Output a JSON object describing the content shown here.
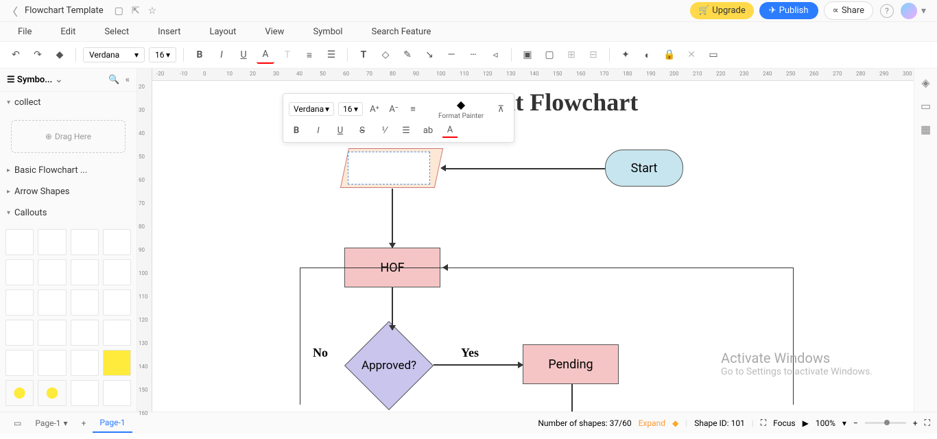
{
  "titlebar": {
    "doc_title": "Flowchart Template",
    "upgrade": "Upgrade",
    "publish": "Publish",
    "share": "Share"
  },
  "menus": {
    "file": "File",
    "edit": "Edit",
    "select": "Select",
    "insert": "Insert",
    "layout": "Layout",
    "view": "View",
    "symbol": "Symbol",
    "search": "Search Feature"
  },
  "toolbar": {
    "font": "Verdana",
    "size": "16"
  },
  "left": {
    "title": "Symbo...",
    "collect": "collect",
    "drag": "Drag Here",
    "basic": "Basic Flowchart ...",
    "arrows": "Arrow Shapes",
    "callouts": "Callouts"
  },
  "float": {
    "font": "Verdana",
    "size": "16",
    "format_painter": "Format Painter"
  },
  "flow": {
    "title": "Requirement Flowchart",
    "start": "Start",
    "hof": "HOF",
    "approved": "Approved?",
    "pending": "Pending",
    "no": "No",
    "yes": "Yes"
  },
  "tabs": {
    "page1": "Page-1",
    "page1_active": "Page-1"
  },
  "status": {
    "shapes_label": "Number of shapes: ",
    "shapes_count": "37/60",
    "expand": "Expand",
    "shape_id_label": "Shape ID: ",
    "shape_id": "101",
    "focus": "Focus",
    "zoom": "100%"
  },
  "watermark": {
    "l1": "Activate Windows",
    "l2": "Go to Settings to activate Windows."
  },
  "ruler_h": [
    "-20",
    "-10",
    "0",
    "10",
    "20",
    "30",
    "40",
    "50",
    "60",
    "70",
    "80",
    "90",
    "100",
    "110",
    "120",
    "130",
    "140",
    "150",
    "160",
    "170",
    "180",
    "190",
    "200",
    "210",
    "220",
    "230",
    "240",
    "250",
    "260",
    "270",
    "280",
    "290",
    "300"
  ],
  "ruler_v": [
    "20",
    "30",
    "40",
    "50",
    "60",
    "70",
    "80",
    "90",
    "100",
    "110",
    "120",
    "130",
    "140",
    "150",
    "160"
  ]
}
